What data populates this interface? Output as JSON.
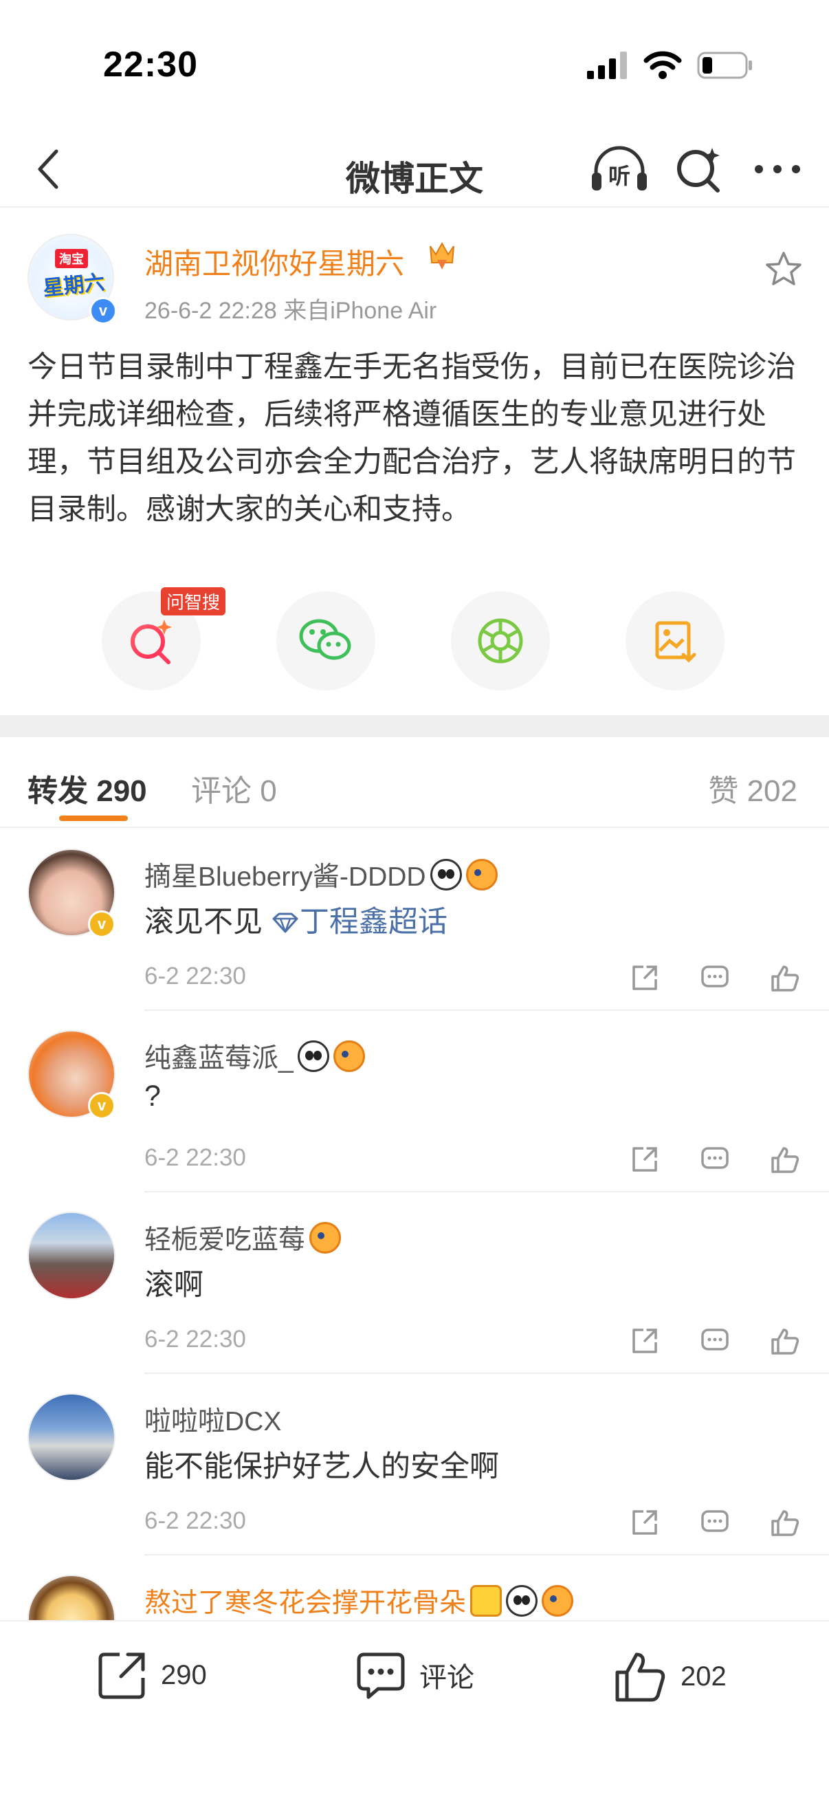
{
  "status_bar": {
    "time": "22:30"
  },
  "nav": {
    "title": "微博正文",
    "listen_label": "听"
  },
  "post": {
    "author": "湖南卫视你好星期六",
    "meta": "26-6-2 22:28  来自iPhone Air",
    "avatar_text_top": "淘宝",
    "avatar_text_main": "星期六",
    "body": "今日节目录制中丁程鑫左手无名指受伤，目前已在医院诊治并完成详细检查，后续将严格遵循医生的专业意见进行处理，节目组及公司亦会全力配合治疗，艺人将缺席明日的节目录制。感谢大家的关心和支持。"
  },
  "share": {
    "ask_tag": "问智搜"
  },
  "tabs": {
    "repost_label": "转发",
    "repost_count": "290",
    "comment_label": "评论",
    "comment_count": "0",
    "like_label": "赞",
    "like_count": "202"
  },
  "comments": [
    {
      "name": "摘星Blueberry酱-DDDD",
      "text": "滚见不见",
      "topic": "丁程鑫超话",
      "time": "6-2 22:30"
    },
    {
      "name": "纯鑫蓝莓派_",
      "text": "?",
      "time": "6-2 22:30"
    },
    {
      "name": "轻栀爱吃蓝莓",
      "text": "滚啊",
      "time": "6-2 22:30"
    },
    {
      "name": "啦啦啦DCX",
      "text": "能不能保护好艺人的安全啊",
      "time": "6-2 22:30"
    },
    {
      "name": "熬过了寒冬花会撑开花骨朵"
    }
  ],
  "bottom_bar": {
    "repost_count": "290",
    "comment_label": "评论",
    "like_count": "202"
  },
  "colors": {
    "accent_orange": "#f0801a",
    "topic_blue": "#4b6fa8",
    "verified_blue": "#3d8cf5",
    "verified_gold": "#f2b51b",
    "tag_red": "#e8412f"
  },
  "battery_level": 0.2
}
